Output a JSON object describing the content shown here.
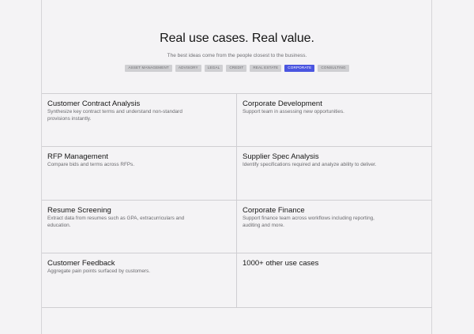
{
  "hero": {
    "title": "Real use cases. Real value.",
    "subtitle": "The best ideas come from the people closest to the business."
  },
  "tags": [
    {
      "label": "ASSET MANAGEMENT",
      "active": false
    },
    {
      "label": "ADVISORY",
      "active": false
    },
    {
      "label": "LEGAL",
      "active": false
    },
    {
      "label": "CREDIT",
      "active": false
    },
    {
      "label": "REAL ESTATE",
      "active": false
    },
    {
      "label": "CORPORATE",
      "active": true
    },
    {
      "label": "CONSULTING",
      "active": false
    }
  ],
  "colors": {
    "accent": "#4a55e0",
    "tag_bg": "#cfcfd2"
  },
  "use_cases": [
    {
      "title": "Customer Contract Analysis",
      "desc": "Synthesize key contract terms and understand non-standard provisions instantly."
    },
    {
      "title": "Corporate Development",
      "desc": "Support team in assessing new opportunities."
    },
    {
      "title": "RFP Management",
      "desc": "Compare bids and terms across RFPs."
    },
    {
      "title": "Supplier Spec Analysis",
      "desc": "Identify specifications required and analyze ability to deliver."
    },
    {
      "title": "Resume Screening",
      "desc": "Extract data from resumes such as GPA, extracurriculars and education."
    },
    {
      "title": "Corporate Finance",
      "desc": "Support finance team across workflows including reporting, auditing and more."
    },
    {
      "title": "Customer Feedback",
      "desc": "Aggregate pain points surfaced by customers."
    },
    {
      "title": "1000+ other use cases",
      "desc": ""
    }
  ]
}
